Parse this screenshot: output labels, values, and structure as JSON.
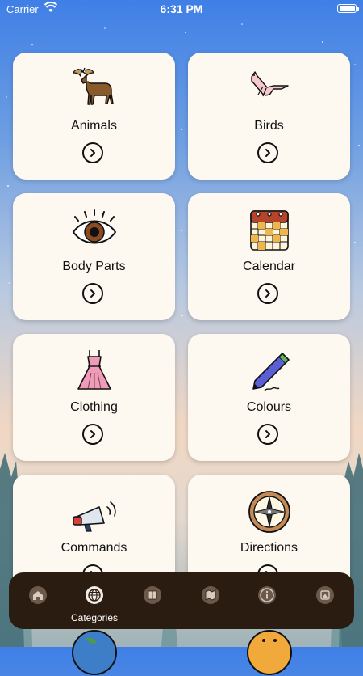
{
  "status_bar": {
    "carrier": "Carrier",
    "time": "6:31 PM"
  },
  "categories": [
    {
      "label": "Animals",
      "icon": "moose-icon"
    },
    {
      "label": "Birds",
      "icon": "bird-icon"
    },
    {
      "label": "Body Parts",
      "icon": "eye-icon"
    },
    {
      "label": "Calendar",
      "icon": "calendar-icon"
    },
    {
      "label": "Clothing",
      "icon": "dress-icon"
    },
    {
      "label": "Colours",
      "icon": "pen-icon"
    },
    {
      "label": "Commands",
      "icon": "megaphone-icon"
    },
    {
      "label": "Directions",
      "icon": "compass-icon"
    }
  ],
  "tabbar": {
    "active_label": "Categories",
    "tabs": [
      "home-icon",
      "globe-icon",
      "book-icon",
      "map-icon",
      "info-icon",
      "profile-icon"
    ]
  },
  "colors": {
    "card": "#fdf8f0",
    "tabbar": "#2b1c12"
  }
}
